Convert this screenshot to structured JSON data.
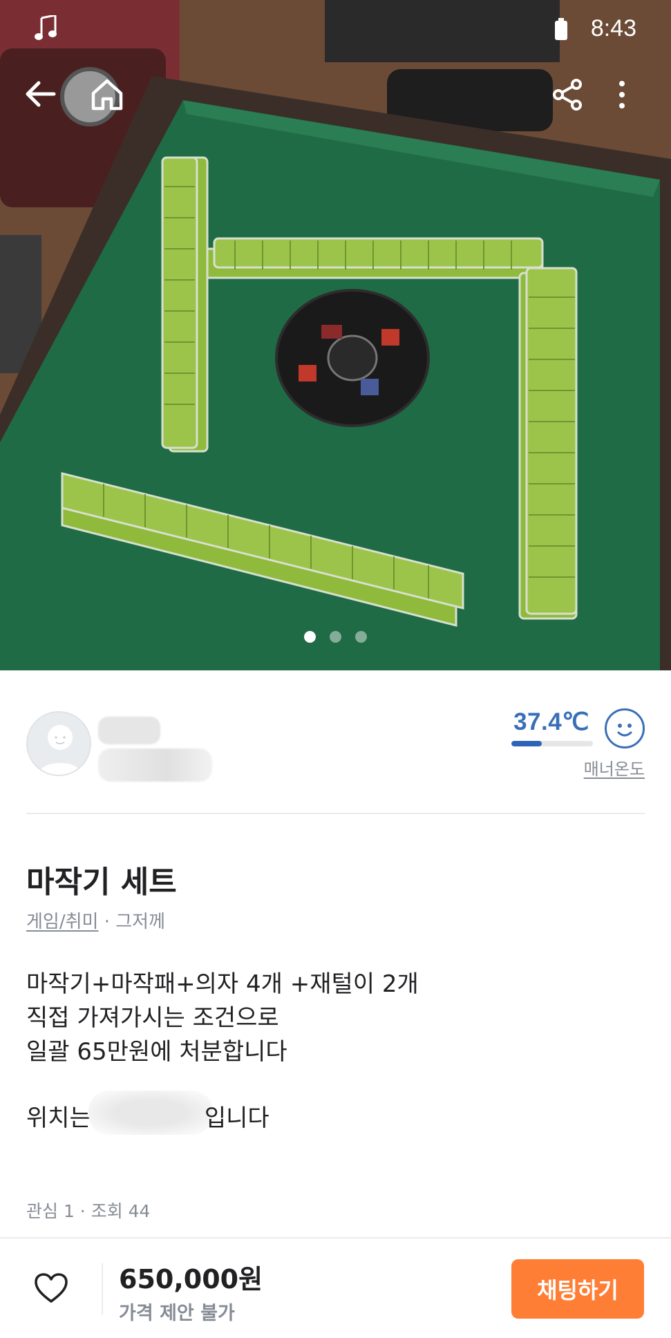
{
  "status_bar": {
    "time": "8:43"
  },
  "photo": {
    "page_count": 3,
    "active_index": 0
  },
  "seller": {
    "manner_temperature": "37.4℃",
    "manner_temperature_value": 37.4,
    "manner_label": "매너온도"
  },
  "post": {
    "title": "마작기 세트",
    "category": "게임/취미",
    "time_sep": " · ",
    "time": "그저께",
    "body_lines": [
      "마작기+마작패+의자 4개 +재털이 2개",
      "직접 가져가시는 조건으로",
      "일괄 65만원에 처분합니다"
    ],
    "location_prefix": "위치는",
    "location_suffix": "입니다",
    "stats": "관심 1 · 조회 44"
  },
  "bottom_bar": {
    "price": "650,000원",
    "negotiation": "가격 제안 불가",
    "chat_button": "채팅하기"
  },
  "colors": {
    "accent": "#ff7e36",
    "temperature": "#3a6fb8",
    "table_felt": "#1f6b45",
    "tile_green": "#8fba3c"
  },
  "icons": [
    "music-icon",
    "battery-icon",
    "back-arrow-icon",
    "home-icon",
    "share-icon",
    "more-vertical-icon",
    "smile-face-icon",
    "heart-icon"
  ]
}
